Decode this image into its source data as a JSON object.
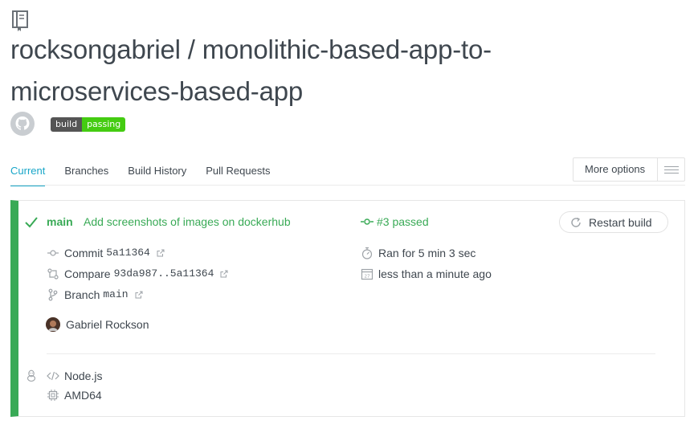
{
  "repo": {
    "title": "rocksongabriel / monolithic-based-app-to-microservices-based-app",
    "badge_left": "build",
    "badge_right": "passing"
  },
  "tabs": [
    {
      "label": "Current",
      "active": true
    },
    {
      "label": "Branches",
      "active": false
    },
    {
      "label": "Build History",
      "active": false
    },
    {
      "label": "Pull Requests",
      "active": false
    }
  ],
  "more_options": {
    "label": "More options"
  },
  "build": {
    "branch": "main",
    "message": "Add screenshots of images on dockerhub",
    "status": "#3 passed",
    "restart_label": "Restart build",
    "commit_label": "Commit",
    "commit_sha": "5a11364",
    "compare_label": "Compare",
    "compare_range": "93da987..5a11364",
    "branch_label": "Branch",
    "branch_value": "main",
    "duration": "Ran for 5 min 3 sec",
    "finished": "less than a minute ago",
    "author": "Gabriel Rockson",
    "language": "Node.js",
    "arch": "AMD64"
  },
  "colors": {
    "passed": "#39aa56",
    "active_tab": "#18a6c8",
    "text": "#3f474f"
  }
}
